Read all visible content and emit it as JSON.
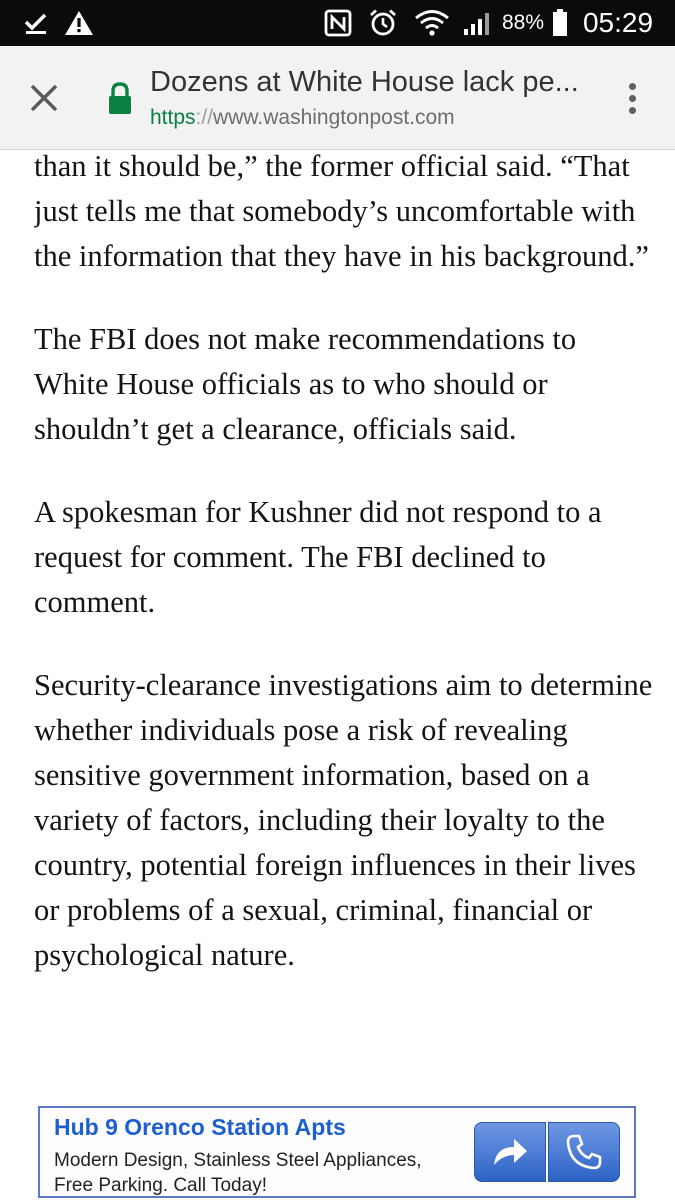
{
  "status_bar": {
    "battery_percent": "88%",
    "time": "05:29",
    "icons": [
      "download-done-icon",
      "warning-icon",
      "nfc-icon",
      "alarm-icon",
      "wifi-icon",
      "signal-icon",
      "battery-icon"
    ]
  },
  "browser": {
    "page_title": "Dozens at White House lack pe...",
    "url_scheme": "https",
    "url_separator": "://",
    "url_host": "www.washingtonpost.com",
    "close_icon": "close-icon",
    "lock_icon": "lock-icon",
    "menu_icon": "overflow-menu-icon",
    "secure_color": "#0b8043"
  },
  "article": {
    "paragraphs": [
      "than it should be,” the former official said. “That just tells me that somebody’s uncomfortable with the information that they have in his background.”",
      "The FBI does not make recommendations to White House officials as to who should or shouldn’t get a clearance, officials said.",
      "A spokesman for Kushner did not respond to a request for comment. The FBI declined to comment.",
      "Security-clearance investigations aim to determine whether individuals pose a risk of revealing sensitive government information, based on a variety of factors, including their loyalty to the country, potential foreign influences in their lives or problems of a sexual, criminal, financial or psychological nature."
    ]
  },
  "ad": {
    "title": "Hub 9 Orenco Station Apts",
    "body": "Modern Design, Stainless Steel Appliances, Free Parking. Call Today!",
    "buttons": [
      "directions-arrow-icon",
      "phone-icon"
    ],
    "accent_color": "#1d5fcf"
  }
}
